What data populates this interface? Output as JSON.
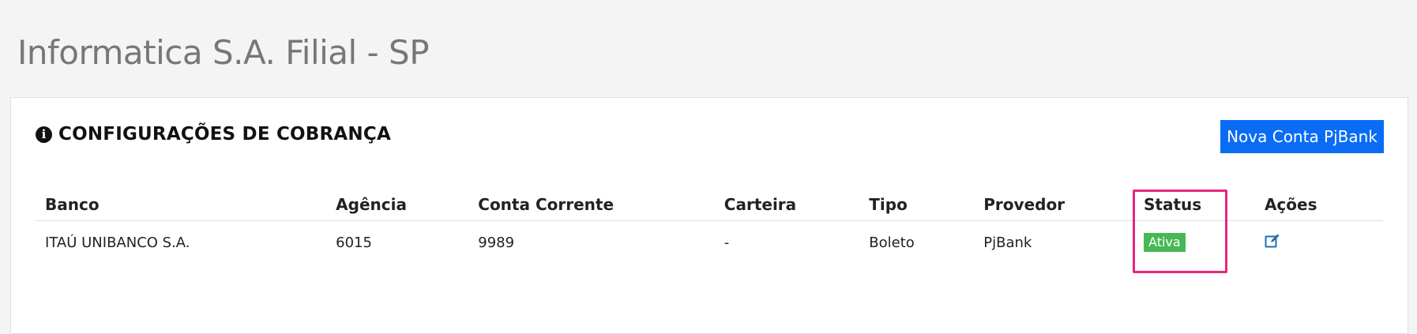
{
  "page": {
    "title": "Informatica S.A. Filial - SP"
  },
  "card": {
    "title": "CONFIGURAÇÕES DE COBRANÇA",
    "info_icon": "info-circle-icon",
    "new_button_label": "Nova Conta PjBank"
  },
  "table": {
    "headers": {
      "banco": "Banco",
      "agencia": "Agência",
      "conta": "Conta Corrente",
      "carteira": "Carteira",
      "tipo": "Tipo",
      "provedor": "Provedor",
      "status": "Status",
      "acoes": "Ações"
    },
    "rows": [
      {
        "banco": "ITAÚ UNIBANCO S.A.",
        "agencia": "6015",
        "conta": "9989",
        "carteira": "-",
        "tipo": "Boleto",
        "provedor": "PjBank",
        "status": "Ativa",
        "action_icon": "edit-icon"
      }
    ]
  },
  "colors": {
    "primary_button": "#0a6cf5",
    "status_active": "#46b955",
    "highlight": "#e8267e"
  }
}
